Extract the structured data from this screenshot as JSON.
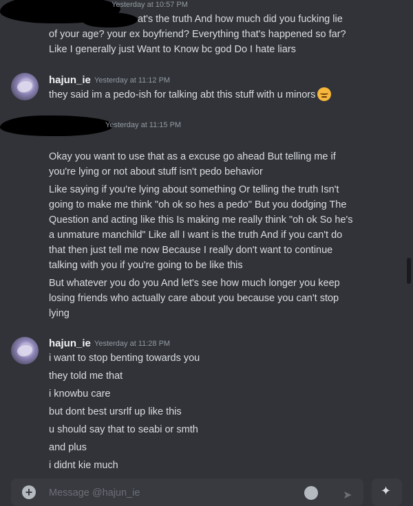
{
  "messages": [
    {
      "timestamp": "Yesterday at 10:57 PM",
      "lines": [
        "at's the truth And how much did you fucking lie",
        "of your age? your ex boyfriend? Everything that's happened so far?",
        "Like I generally just Want to Know bc god Do I hate liars"
      ]
    },
    {
      "username": "hajun_ie",
      "timestamp": "Yesterday at 11:12 PM",
      "lines": [
        "they said im a pedo-ish for talking abt this stuff with u minors"
      ],
      "emoji": "angry-face-emoji"
    },
    {
      "timestamp": "Yesterday at 11:15 PM",
      "lines": [
        "Okay you want to use that as a excuse go ahead But telling me if",
        "you're lying or not about stuff isn't pedo behavior",
        "Like saying if you're lying about something Or telling the truth Isn't",
        "going to make me think \"oh ok so hes a pedo\" But you dodging The",
        "Question and acting like this Is making me really think \"oh ok So he's",
        "a unmature manchild\" Like all I want is the truth And if you can't do",
        "that then just tell me now Because I really don't want to continue",
        "talking with you if you're going to be like this",
        "But whatever you do you And let's see how much longer you keep",
        "losing friends who actually care about you because you can't stop",
        "lying"
      ]
    },
    {
      "username": "hajun_ie",
      "timestamp": "Yesterday at 11:28 PM",
      "lines": [
        "i want to stop benting towards you",
        "they told me that",
        "i knowbu care",
        "but dont best ursrlf up like this",
        "u should say that to seabi or smth",
        "and plus",
        "i didnt kie much"
      ]
    }
  ],
  "composer": {
    "placeholder": "Message @hajun_ie",
    "icons": [
      "plus-icon",
      "emoji-icon",
      "send-icon",
      "gift-icon"
    ]
  },
  "colors": {
    "background": "#313338",
    "text": "#dbdee1",
    "timestamp": "#949ba4",
    "username": "#f2f3f5",
    "input": "#383a40"
  }
}
